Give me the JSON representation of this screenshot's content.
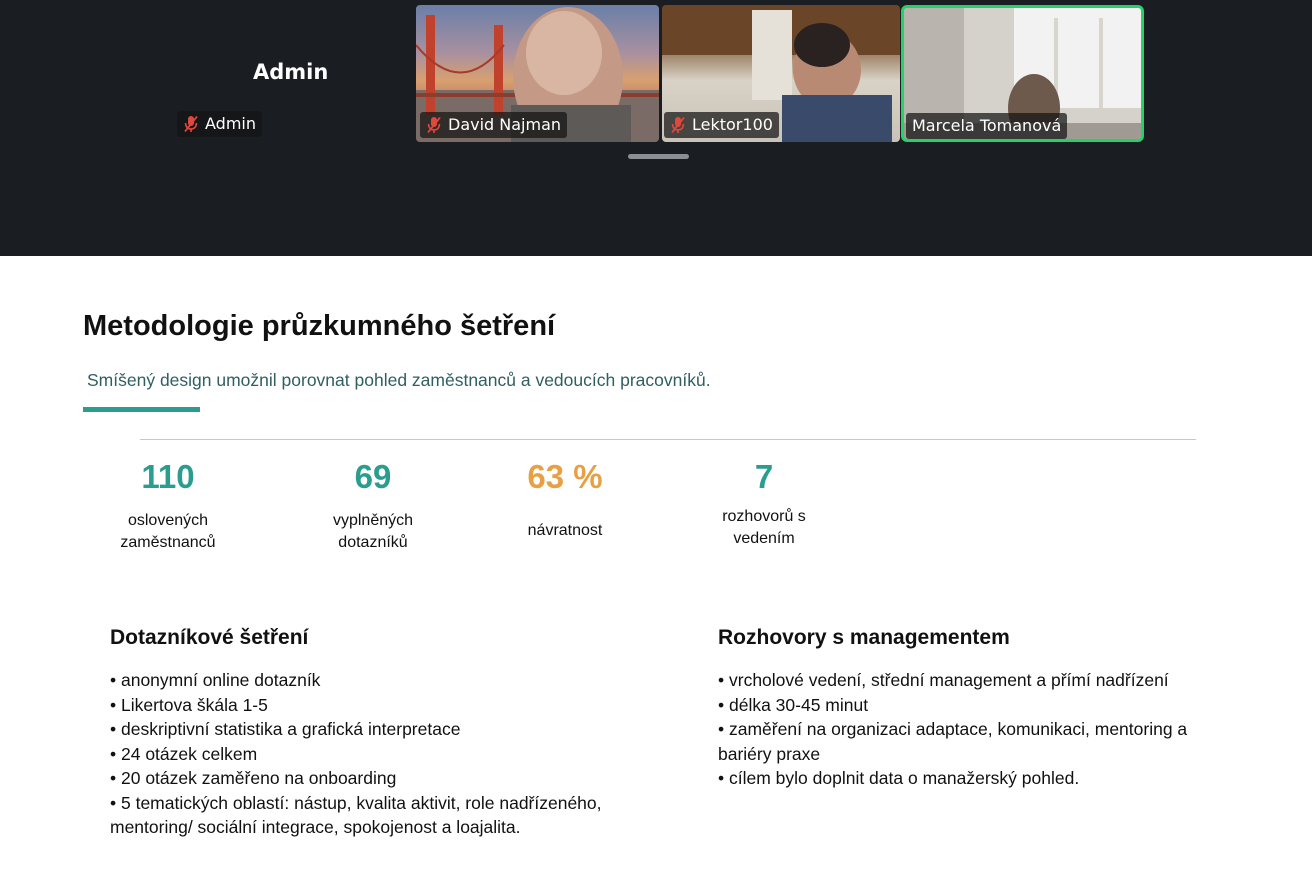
{
  "participants": {
    "self": {
      "display_name": "Admin",
      "chip_label": "Admin",
      "muted": true
    },
    "tiles": [
      {
        "name": "David Najman",
        "muted": true
      },
      {
        "name": "Lektor100",
        "muted": true
      },
      {
        "name": "Marcela Tomanová",
        "muted": false,
        "active_speaker": true
      }
    ]
  },
  "colors": {
    "accent_teal": "#2a9d8f",
    "accent_orange": "#e8a045",
    "speaker_border": "#22d36a",
    "muted_icon": "#e0483e"
  },
  "slide": {
    "title": "Metodologie průzkumného šetření",
    "subtitle": "Smíšený design umožnil porovnat pohled zaměstnanců a vedoucích pracovníků.",
    "stats": [
      {
        "value": "110",
        "label_line1": "oslovených",
        "label_line2": "zaměstnanců"
      },
      {
        "value": "69",
        "label_line1": "vyplněných",
        "label_line2": "dotazníků"
      },
      {
        "value": "63 %",
        "label_line1": "návratnost",
        "label_line2": ""
      },
      {
        "value": "7",
        "label_line1": "rozhovorů s",
        "label_line2": "vedením"
      }
    ],
    "left_section": {
      "title": "Dotazníkové šetření",
      "bullets": [
        "• anonymní online dotazník",
        "• Likertova škála 1-5",
        "• deskriptivní statistika a grafická interpretace",
        "• 24 otázek celkem",
        "• 20 otázek zaměřeno na onboarding",
        "•  5 tematických oblastí: nástup, kvalita aktivit, role nadřízeného,",
        "mentoring/ sociální integrace, spokojenost a loajalita."
      ]
    },
    "right_section": {
      "title": "Rozhovory s managementem",
      "bullets": [
        "• vrcholové vedení, střední management a přímí nadřízení",
        "• délka 30-45 minut",
        "• zaměření na organizaci adaptace, komunikaci, mentoring a",
        "bariéry praxe",
        "• cílem bylo doplnit data o manažerský pohled."
      ]
    }
  }
}
